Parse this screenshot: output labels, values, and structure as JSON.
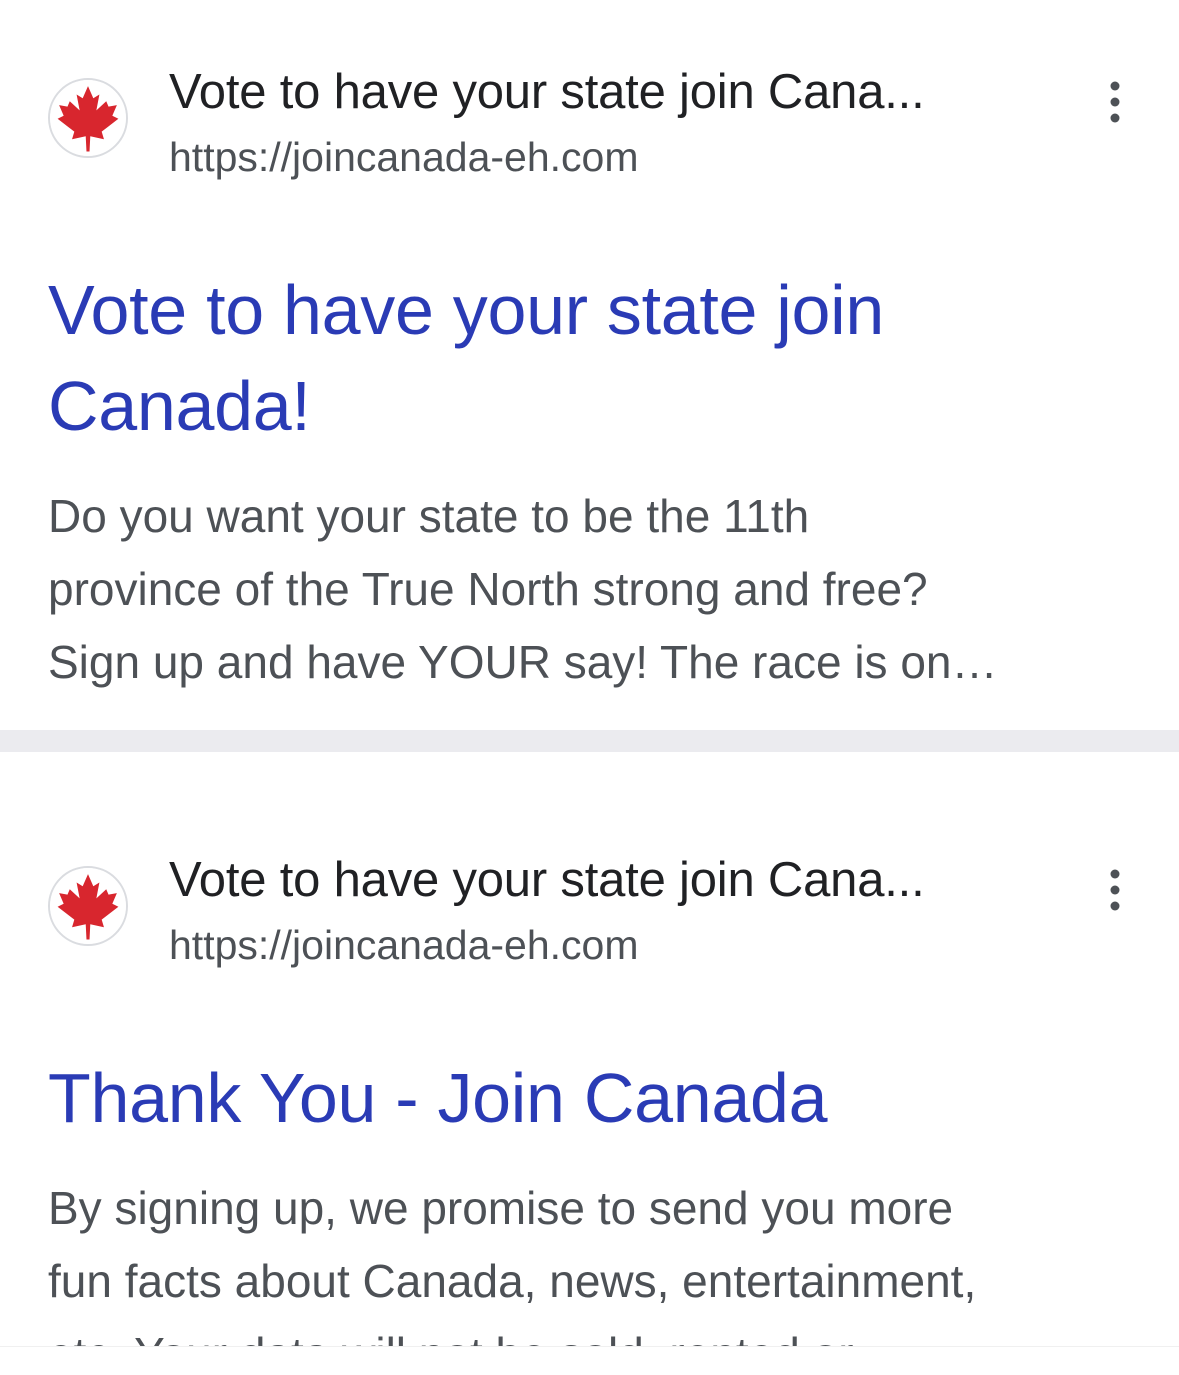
{
  "results": [
    {
      "favicon_icon": "canada-maple-leaf-icon",
      "site_name": "Vote to have your state join Cana...",
      "url": "https://joincanada-eh.com",
      "menu_icon": "more-vert-icon",
      "title_lines": [
        "Vote to have your state join",
        "Canada!"
      ],
      "snippet_lines": [
        "Do you want your state to be the 11th",
        "province of the True North strong and free?",
        "Sign up and have YOUR say! The race is on…"
      ]
    },
    {
      "favicon_icon": "canada-maple-leaf-icon",
      "site_name": "Vote to have your state join Cana...",
      "url": "https://joincanada-eh.com",
      "menu_icon": "more-vert-icon",
      "title_lines": [
        "Thank You - Join Canada"
      ],
      "snippet_lines": [
        "By signing up, we promise to send you more",
        "fun facts about Canada, news, entertainment,",
        "etc. Your data will not be sold, rented or"
      ]
    }
  ],
  "colors": {
    "title_link": "#2a3bb5",
    "site_name": "#202124",
    "url": "#4d5156",
    "snippet": "#4d5156",
    "maple_leaf": "#d8262e",
    "divider": "#ebebef"
  }
}
